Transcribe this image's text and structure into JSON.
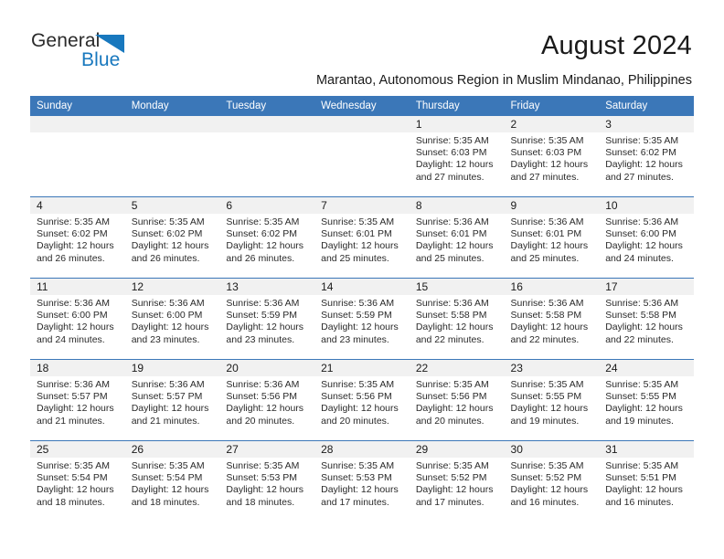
{
  "brand": {
    "name_part1": "General",
    "name_part2": "Blue",
    "flag_icon": "blue-triangle-flag-icon",
    "accent_color": "#1878be"
  },
  "header": {
    "month_title": "August 2024",
    "location": "Marantao, Autonomous Region in Muslim Mindanao, Philippines"
  },
  "calendar": {
    "header_color": "#3b77b8",
    "daynum_band_color": "#f1f1f1",
    "weekday_headers": [
      "Sunday",
      "Monday",
      "Tuesday",
      "Wednesday",
      "Thursday",
      "Friday",
      "Saturday"
    ],
    "weeks": [
      [
        {
          "day": "",
          "sunrise": "",
          "sunset": "",
          "daylight_line1": "",
          "daylight_line2": ""
        },
        {
          "day": "",
          "sunrise": "",
          "sunset": "",
          "daylight_line1": "",
          "daylight_line2": ""
        },
        {
          "day": "",
          "sunrise": "",
          "sunset": "",
          "daylight_line1": "",
          "daylight_line2": ""
        },
        {
          "day": "",
          "sunrise": "",
          "sunset": "",
          "daylight_line1": "",
          "daylight_line2": ""
        },
        {
          "day": "1",
          "sunrise": "Sunrise: 5:35 AM",
          "sunset": "Sunset: 6:03 PM",
          "daylight_line1": "Daylight: 12 hours",
          "daylight_line2": "and 27 minutes."
        },
        {
          "day": "2",
          "sunrise": "Sunrise: 5:35 AM",
          "sunset": "Sunset: 6:03 PM",
          "daylight_line1": "Daylight: 12 hours",
          "daylight_line2": "and 27 minutes."
        },
        {
          "day": "3",
          "sunrise": "Sunrise: 5:35 AM",
          "sunset": "Sunset: 6:02 PM",
          "daylight_line1": "Daylight: 12 hours",
          "daylight_line2": "and 27 minutes."
        }
      ],
      [
        {
          "day": "4",
          "sunrise": "Sunrise: 5:35 AM",
          "sunset": "Sunset: 6:02 PM",
          "daylight_line1": "Daylight: 12 hours",
          "daylight_line2": "and 26 minutes."
        },
        {
          "day": "5",
          "sunrise": "Sunrise: 5:35 AM",
          "sunset": "Sunset: 6:02 PM",
          "daylight_line1": "Daylight: 12 hours",
          "daylight_line2": "and 26 minutes."
        },
        {
          "day": "6",
          "sunrise": "Sunrise: 5:35 AM",
          "sunset": "Sunset: 6:02 PM",
          "daylight_line1": "Daylight: 12 hours",
          "daylight_line2": "and 26 minutes."
        },
        {
          "day": "7",
          "sunrise": "Sunrise: 5:35 AM",
          "sunset": "Sunset: 6:01 PM",
          "daylight_line1": "Daylight: 12 hours",
          "daylight_line2": "and 25 minutes."
        },
        {
          "day": "8",
          "sunrise": "Sunrise: 5:36 AM",
          "sunset": "Sunset: 6:01 PM",
          "daylight_line1": "Daylight: 12 hours",
          "daylight_line2": "and 25 minutes."
        },
        {
          "day": "9",
          "sunrise": "Sunrise: 5:36 AM",
          "sunset": "Sunset: 6:01 PM",
          "daylight_line1": "Daylight: 12 hours",
          "daylight_line2": "and 25 minutes."
        },
        {
          "day": "10",
          "sunrise": "Sunrise: 5:36 AM",
          "sunset": "Sunset: 6:00 PM",
          "daylight_line1": "Daylight: 12 hours",
          "daylight_line2": "and 24 minutes."
        }
      ],
      [
        {
          "day": "11",
          "sunrise": "Sunrise: 5:36 AM",
          "sunset": "Sunset: 6:00 PM",
          "daylight_line1": "Daylight: 12 hours",
          "daylight_line2": "and 24 minutes."
        },
        {
          "day": "12",
          "sunrise": "Sunrise: 5:36 AM",
          "sunset": "Sunset: 6:00 PM",
          "daylight_line1": "Daylight: 12 hours",
          "daylight_line2": "and 23 minutes."
        },
        {
          "day": "13",
          "sunrise": "Sunrise: 5:36 AM",
          "sunset": "Sunset: 5:59 PM",
          "daylight_line1": "Daylight: 12 hours",
          "daylight_line2": "and 23 minutes."
        },
        {
          "day": "14",
          "sunrise": "Sunrise: 5:36 AM",
          "sunset": "Sunset: 5:59 PM",
          "daylight_line1": "Daylight: 12 hours",
          "daylight_line2": "and 23 minutes."
        },
        {
          "day": "15",
          "sunrise": "Sunrise: 5:36 AM",
          "sunset": "Sunset: 5:58 PM",
          "daylight_line1": "Daylight: 12 hours",
          "daylight_line2": "and 22 minutes."
        },
        {
          "day": "16",
          "sunrise": "Sunrise: 5:36 AM",
          "sunset": "Sunset: 5:58 PM",
          "daylight_line1": "Daylight: 12 hours",
          "daylight_line2": "and 22 minutes."
        },
        {
          "day": "17",
          "sunrise": "Sunrise: 5:36 AM",
          "sunset": "Sunset: 5:58 PM",
          "daylight_line1": "Daylight: 12 hours",
          "daylight_line2": "and 22 minutes."
        }
      ],
      [
        {
          "day": "18",
          "sunrise": "Sunrise: 5:36 AM",
          "sunset": "Sunset: 5:57 PM",
          "daylight_line1": "Daylight: 12 hours",
          "daylight_line2": "and 21 minutes."
        },
        {
          "day": "19",
          "sunrise": "Sunrise: 5:36 AM",
          "sunset": "Sunset: 5:57 PM",
          "daylight_line1": "Daylight: 12 hours",
          "daylight_line2": "and 21 minutes."
        },
        {
          "day": "20",
          "sunrise": "Sunrise: 5:36 AM",
          "sunset": "Sunset: 5:56 PM",
          "daylight_line1": "Daylight: 12 hours",
          "daylight_line2": "and 20 minutes."
        },
        {
          "day": "21",
          "sunrise": "Sunrise: 5:35 AM",
          "sunset": "Sunset: 5:56 PM",
          "daylight_line1": "Daylight: 12 hours",
          "daylight_line2": "and 20 minutes."
        },
        {
          "day": "22",
          "sunrise": "Sunrise: 5:35 AM",
          "sunset": "Sunset: 5:56 PM",
          "daylight_line1": "Daylight: 12 hours",
          "daylight_line2": "and 20 minutes."
        },
        {
          "day": "23",
          "sunrise": "Sunrise: 5:35 AM",
          "sunset": "Sunset: 5:55 PM",
          "daylight_line1": "Daylight: 12 hours",
          "daylight_line2": "and 19 minutes."
        },
        {
          "day": "24",
          "sunrise": "Sunrise: 5:35 AM",
          "sunset": "Sunset: 5:55 PM",
          "daylight_line1": "Daylight: 12 hours",
          "daylight_line2": "and 19 minutes."
        }
      ],
      [
        {
          "day": "25",
          "sunrise": "Sunrise: 5:35 AM",
          "sunset": "Sunset: 5:54 PM",
          "daylight_line1": "Daylight: 12 hours",
          "daylight_line2": "and 18 minutes."
        },
        {
          "day": "26",
          "sunrise": "Sunrise: 5:35 AM",
          "sunset": "Sunset: 5:54 PM",
          "daylight_line1": "Daylight: 12 hours",
          "daylight_line2": "and 18 minutes."
        },
        {
          "day": "27",
          "sunrise": "Sunrise: 5:35 AM",
          "sunset": "Sunset: 5:53 PM",
          "daylight_line1": "Daylight: 12 hours",
          "daylight_line2": "and 18 minutes."
        },
        {
          "day": "28",
          "sunrise": "Sunrise: 5:35 AM",
          "sunset": "Sunset: 5:53 PM",
          "daylight_line1": "Daylight: 12 hours",
          "daylight_line2": "and 17 minutes."
        },
        {
          "day": "29",
          "sunrise": "Sunrise: 5:35 AM",
          "sunset": "Sunset: 5:52 PM",
          "daylight_line1": "Daylight: 12 hours",
          "daylight_line2": "and 17 minutes."
        },
        {
          "day": "30",
          "sunrise": "Sunrise: 5:35 AM",
          "sunset": "Sunset: 5:52 PM",
          "daylight_line1": "Daylight: 12 hours",
          "daylight_line2": "and 16 minutes."
        },
        {
          "day": "31",
          "sunrise": "Sunrise: 5:35 AM",
          "sunset": "Sunset: 5:51 PM",
          "daylight_line1": "Daylight: 12 hours",
          "daylight_line2": "and 16 minutes."
        }
      ]
    ]
  }
}
